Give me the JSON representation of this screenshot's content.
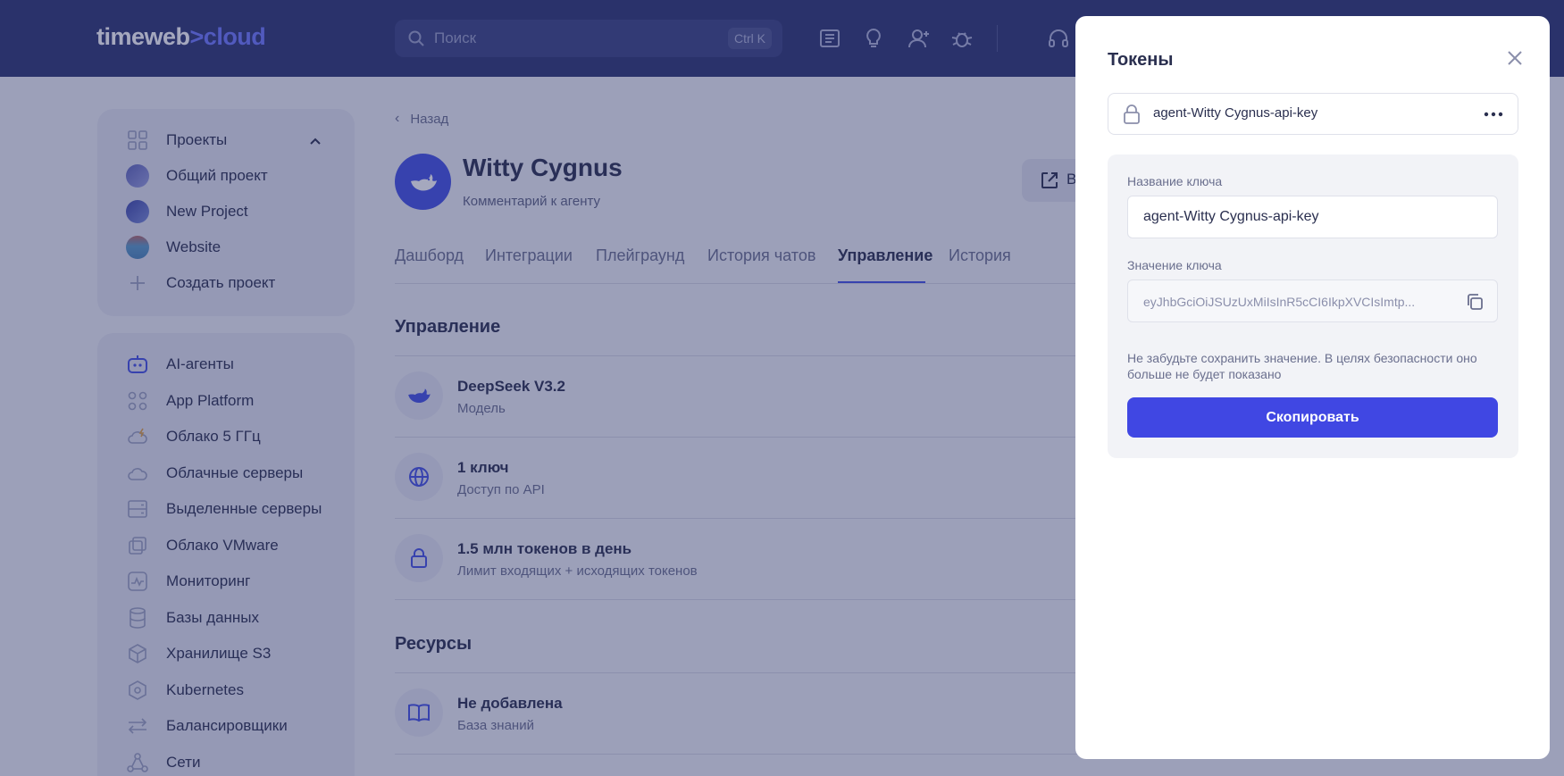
{
  "header": {
    "logo_main": "timeweb",
    "logo_accent": ">cloud",
    "search_placeholder": "Поиск",
    "search_shortcut": "Ctrl K",
    "icons": [
      "docs-icon",
      "lightbulb-icon",
      "add-user-icon",
      "bug-icon",
      "headset-icon"
    ]
  },
  "sidebar": {
    "projects_label": "Проекты",
    "projects": [
      {
        "label": "Общий проект",
        "color": "#7a7fc7"
      },
      {
        "label": "New Project",
        "color": "#5c63b8"
      },
      {
        "label": "Website",
        "color": "#6aa0c8"
      }
    ],
    "create_project": "Создать проект",
    "nav": [
      {
        "label": "AI-агенты",
        "icon": "robot-icon"
      },
      {
        "label": "App Platform",
        "icon": "apps-icon"
      },
      {
        "label": "Облако 5 ГГц",
        "icon": "cloud-bolt-icon"
      },
      {
        "label": "Облачные серверы",
        "icon": "cloud-icon"
      },
      {
        "label": "Выделенные серверы",
        "icon": "server-icon"
      },
      {
        "label": "Облако VMware",
        "icon": "vmware-icon"
      },
      {
        "label": "Мониторинг",
        "icon": "monitoring-icon"
      },
      {
        "label": "Базы данных",
        "icon": "database-icon"
      },
      {
        "label": "Хранилище S3",
        "icon": "storage-icon"
      },
      {
        "label": "Kubernetes",
        "icon": "kubernetes-icon"
      },
      {
        "label": "Балансировщики",
        "icon": "balancer-icon"
      },
      {
        "label": "Сети",
        "icon": "network-icon"
      }
    ]
  },
  "main": {
    "back_label": "Назад",
    "agent_name": "Witty Cygnus",
    "agent_comment": "Комментарий к агенту",
    "ext_label": "В",
    "tabs": [
      "Дашборд",
      "Интеграции",
      "Плейграунд",
      "История чатов",
      "Управление",
      "История"
    ],
    "active_tab": "Управление",
    "management_title": "Управление",
    "management_rows": [
      {
        "title": "DeepSeek V3.2",
        "subtitle": "Модель"
      },
      {
        "title": "1 ключ",
        "subtitle": "Доступ по API"
      },
      {
        "title": "1.5 млн токенов в день",
        "subtitle": "Лимит входящих + исходящих токенов"
      }
    ],
    "resources_title": "Ресурсы",
    "resources_rows": [
      {
        "title": "Не добавлена",
        "subtitle": "База знаний"
      }
    ]
  },
  "modal": {
    "title": "Токены",
    "token_name": "agent-Witty Cygnus-api-key",
    "key_name_label": "Название ключа",
    "key_name_value": "agent-Witty Cygnus-api-key",
    "key_value_label": "Значение ключа",
    "key_value": "eyJhbGciOiJSUzUxMiIsInR5cCI6IkpXVCIsImtp...",
    "note": "Не забудьте сохранить значение. В целях безопасности оно больше не будет показано",
    "copy_button": "Скопировать",
    "accent_color": "#4047e3"
  }
}
